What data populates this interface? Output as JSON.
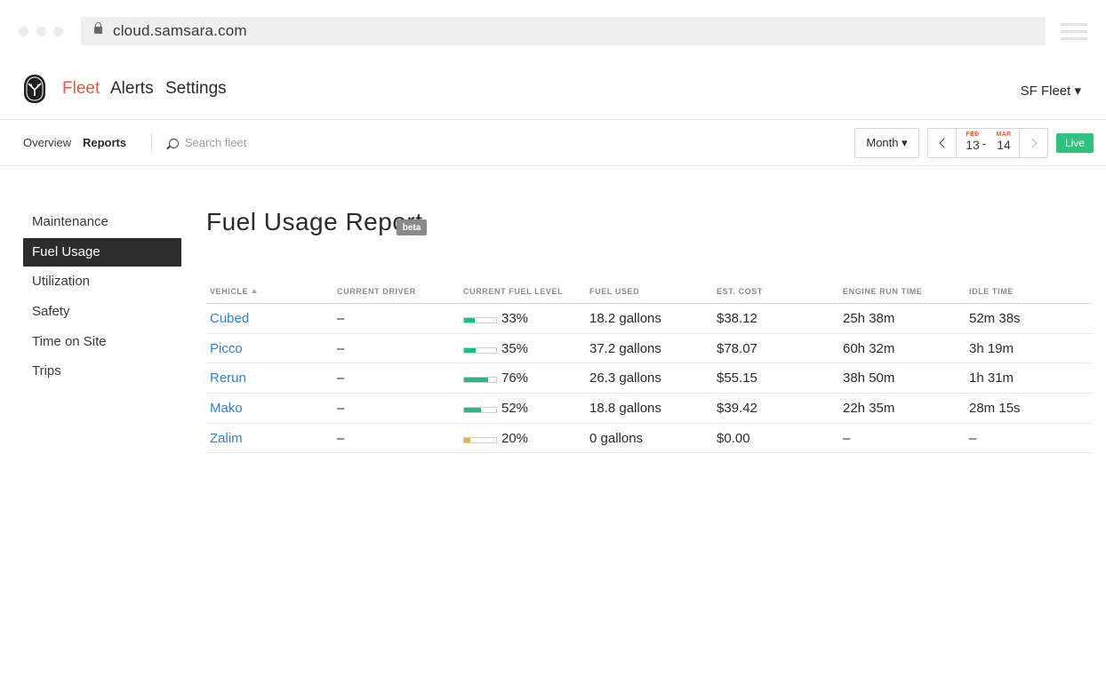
{
  "browser": {
    "url": "cloud.samsara.com"
  },
  "nav": {
    "links": [
      "Fleet",
      "Alerts",
      "Settings"
    ],
    "fleet_selector": "SF Fleet ▾"
  },
  "subnav": {
    "links": [
      "Overview",
      "Reports"
    ],
    "search_placeholder": "Search fleet",
    "range_button": "Month ▾",
    "start_month": "FEB",
    "start_day": "13",
    "end_month": "MAR",
    "end_day": "14",
    "dash": "-",
    "live": "Live"
  },
  "sidebar": {
    "items": [
      "Maintenance",
      "Fuel Usage",
      "Utilization",
      "Safety",
      "Time on Site",
      "Trips"
    ],
    "active": "Fuel Usage"
  },
  "report": {
    "title": "Fuel Usage Report",
    "badge": "beta",
    "columns": [
      "VEHICLE",
      "CURRENT DRIVER",
      "CURRENT FUEL LEVEL",
      "FUEL USED",
      "EST. COST",
      "ENGINE RUN TIME",
      "IDLE TIME"
    ],
    "rows": [
      {
        "vehicle": "Cubed",
        "driver": "–",
        "fuel_level": 33,
        "fuel_text": "33%",
        "fuel_used": "18.2 gallons",
        "cost": "$38.12",
        "run_time": "25h 38m",
        "idle_time": "52m 38s"
      },
      {
        "vehicle": "Picco",
        "driver": "–",
        "fuel_level": 35,
        "fuel_text": "35%",
        "fuel_used": "37.2 gallons",
        "cost": "$78.07",
        "run_time": "60h 32m",
        "idle_time": "3h 19m"
      },
      {
        "vehicle": "Rerun",
        "driver": "–",
        "fuel_level": 76,
        "fuel_text": "76%",
        "fuel_used": "26.3 gallons",
        "cost": "$55.15",
        "run_time": "38h 50m",
        "idle_time": "1h 31m"
      },
      {
        "vehicle": "Mako",
        "driver": "–",
        "fuel_level": 52,
        "fuel_text": "52%",
        "fuel_used": "18.8 gallons",
        "cost": "$39.42",
        "run_time": "22h 35m",
        "idle_time": "28m 15s"
      },
      {
        "vehicle": "Zalim",
        "driver": "–",
        "fuel_level": 20,
        "fuel_text": "20%",
        "fuel_used": "0 gallons",
        "cost": "$0.00",
        "run_time": "–",
        "idle_time": "–"
      }
    ]
  },
  "colors": {
    "accent": "#e8553e",
    "link": "#2f7fd0",
    "fuel_ok": "#1fbf84",
    "fuel_low": "#f0b429",
    "live": "#2ec27e"
  }
}
